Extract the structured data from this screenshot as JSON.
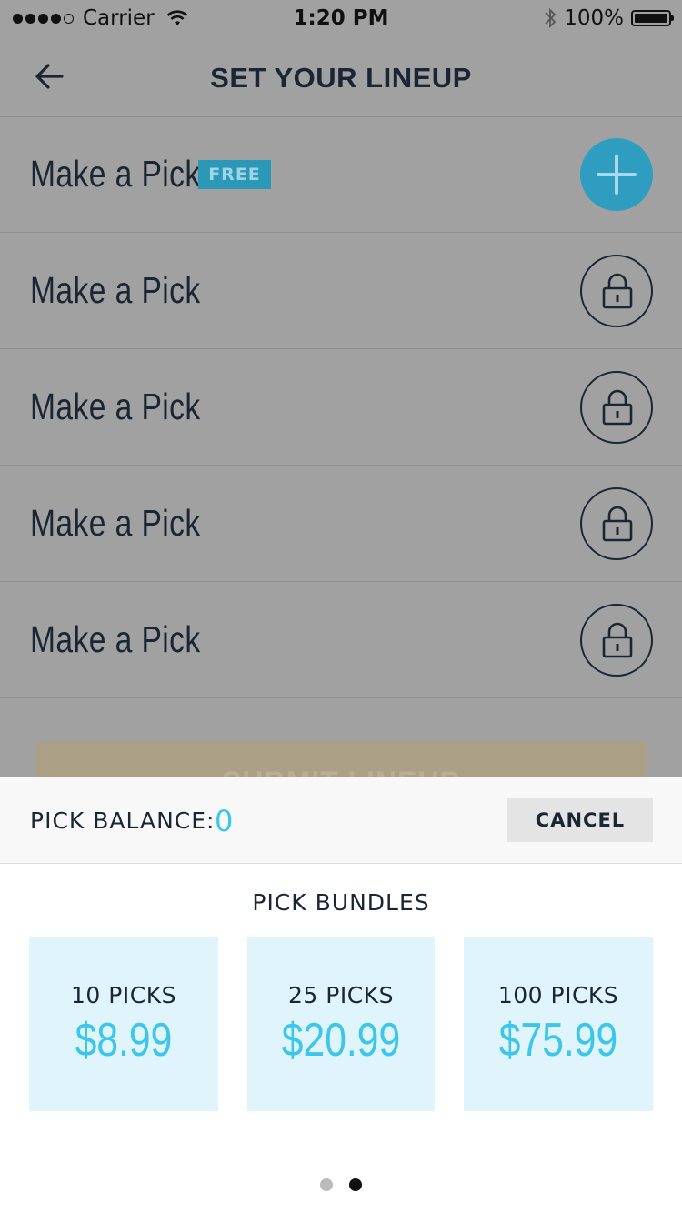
{
  "status_bar": {
    "carrier": "Carrier",
    "time": "1:20 PM",
    "battery": "100%"
  },
  "header": {
    "title": "SET YOUR LINEUP"
  },
  "rows": [
    {
      "label": "Make a Pick",
      "badge": "FREE",
      "action": "plus-icon"
    },
    {
      "label": "Make a Pick",
      "action": "lock-icon"
    },
    {
      "label": "Make a Pick",
      "action": "lock-icon"
    },
    {
      "label": "Make a Pick",
      "action": "lock-icon"
    },
    {
      "label": "Make a Pick",
      "action": "lock-icon"
    }
  ],
  "submit_label": "SUBMIT LINEUP",
  "sheet": {
    "balance_label": "PICK BALANCE:",
    "balance_value": "0",
    "cancel_label": "CANCEL",
    "bundles_title": "PICK BUNDLES",
    "bundles": [
      {
        "picks": "10 PICKS",
        "price": "$8.99"
      },
      {
        "picks": "25 PICKS",
        "price": "$20.99"
      },
      {
        "picks": "100 PICKS",
        "price": "$75.99"
      }
    ],
    "pager": {
      "pages": 2,
      "current": 2
    }
  },
  "colors": {
    "accent": "#3cc6ec",
    "text": "#1b2634",
    "overlay_bg": "#a1a1a1",
    "bundle_bg": "#dff4fb"
  }
}
